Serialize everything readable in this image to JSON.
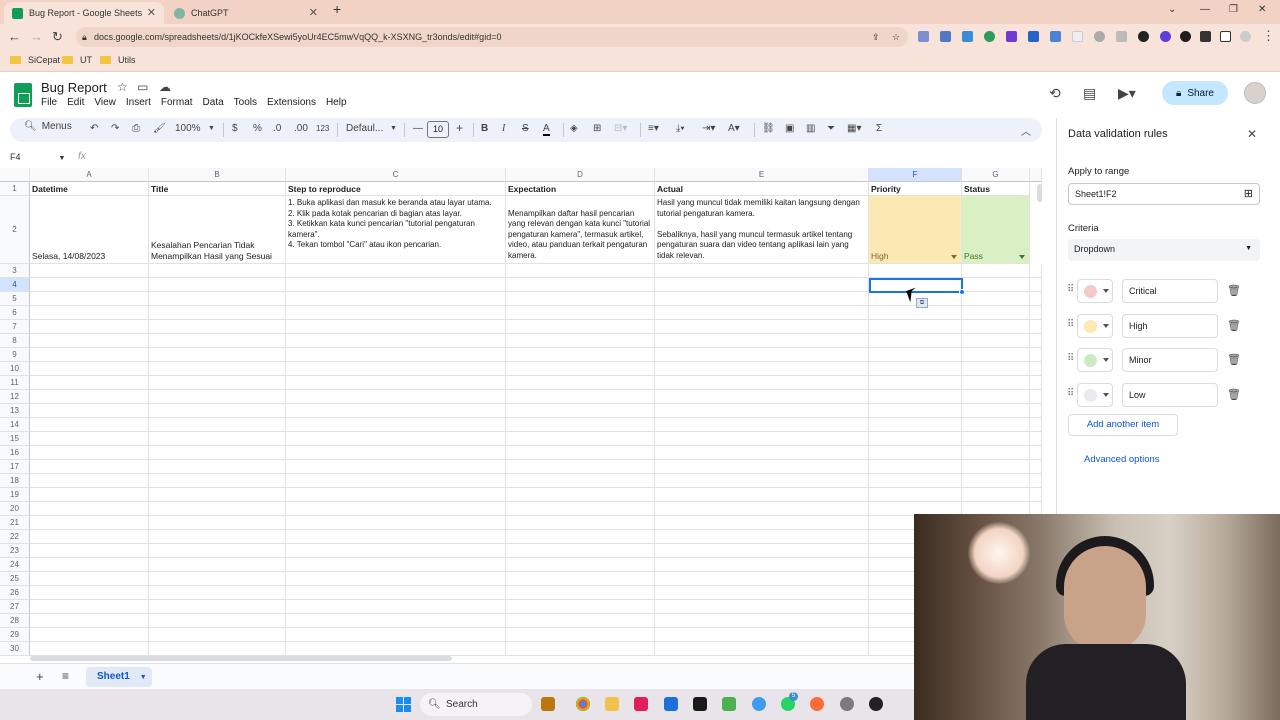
{
  "browser": {
    "tabs": [
      {
        "title": "Bug Report - Google Sheets",
        "active": true,
        "icon": "sheets-icon",
        "icon_color": "#0f9d58"
      },
      {
        "title": "ChatGPT",
        "active": false,
        "icon": "chatgpt-icon",
        "icon_color": "#7fb5a3"
      }
    ],
    "url": "docs.google.com/spreadsheets/d/1jKOCkfeXSewi5yoUr4EC5mwVqQQ_k-XSXNG_tr3onds/edit#gid=0",
    "bookmarks": [
      "SiCepat",
      "UT",
      "Utils"
    ]
  },
  "sheets": {
    "doc_title": "Bug Report",
    "menus": [
      "File",
      "Edit",
      "View",
      "Insert",
      "Format",
      "Data",
      "Tools",
      "Extensions",
      "Help"
    ],
    "share_label": "Share",
    "toolbar": {
      "menus_search": "Menus",
      "zoom": "100%",
      "currency": "$",
      "percent": "%",
      "dec_decrease": ".0",
      "dec_increase": ".00",
      "number_format": "123",
      "font": "Defaul...",
      "font_size": "10"
    },
    "name_box": "F4",
    "fx": "fx"
  },
  "grid": {
    "columns": [
      "A",
      "B",
      "C",
      "D",
      "E",
      "F",
      "G"
    ],
    "selected_column": "F",
    "selected_row": 4,
    "rows": [
      "1",
      "2",
      "3",
      "4",
      "5",
      "6",
      "7",
      "8",
      "9",
      "10",
      "11",
      "12",
      "13",
      "14",
      "15",
      "16",
      "17",
      "18",
      "19",
      "20",
      "21",
      "22",
      "23",
      "24",
      "25",
      "26",
      "27",
      "28",
      "29",
      "30"
    ],
    "header_row": [
      "Datetime",
      "Title",
      "Step to reproduce",
      "Expectation",
      "Actual",
      "Priority",
      "Status"
    ],
    "row2": {
      "datetime": "Selasa, 14/08/2023",
      "title": "Kesalahan Pencarian Tidak Menampilkan Hasil yang Sesuai",
      "steps": "1. Buka aplikasi dan masuk ke beranda atau layar utama.\n2. Klik pada kotak pencarian di bagian atas layar.\n3. Ketikkan kata kunci pencarian \"tutorial pengaturan kamera\".\n4. Tekan tombol \"Cari\" atau ikon pencarian.",
      "expectation": "Menampilkan daftar hasil pencarian yang relevan dengan kata kunci \"tutorial pengaturan kamera\", termasuk artikel, video, atau panduan terkait pengaturan kamera.",
      "actual": "Hasil yang muncul tidak memiliki kaitan langsung dengan tutorial pengaturan kamera.\n\nSebaliknya, hasil yang muncul termasuk artikel tentang pengaturan suara dan video tentang aplikasi lain yang tidak relevan.",
      "priority": "High",
      "status": "Pass"
    },
    "colors": {
      "priority_high_bg": "#fce8b2",
      "priority_high_text": "#7a6a2f",
      "status_pass_bg": "#d9efc4",
      "status_pass_text": "#3c7a21"
    }
  },
  "sheet_tab": "Sheet1",
  "panel": {
    "title": "Data validation rules",
    "apply_label": "Apply to range",
    "range": "Sheet1!F2",
    "criteria_label": "Criteria",
    "criteria_value": "Dropdown",
    "items": [
      {
        "label": "Critical",
        "color": "#f6c9cb"
      },
      {
        "label": "High",
        "color": "#fce8b2"
      },
      {
        "label": "Minor",
        "color": "#ccebc5"
      },
      {
        "label": "Low",
        "color": "#e8eaed"
      }
    ],
    "add_item": "Add another item",
    "advanced": "Advanced options"
  },
  "taskbar": {
    "search": "Search",
    "whatsapp_badge": "5"
  }
}
